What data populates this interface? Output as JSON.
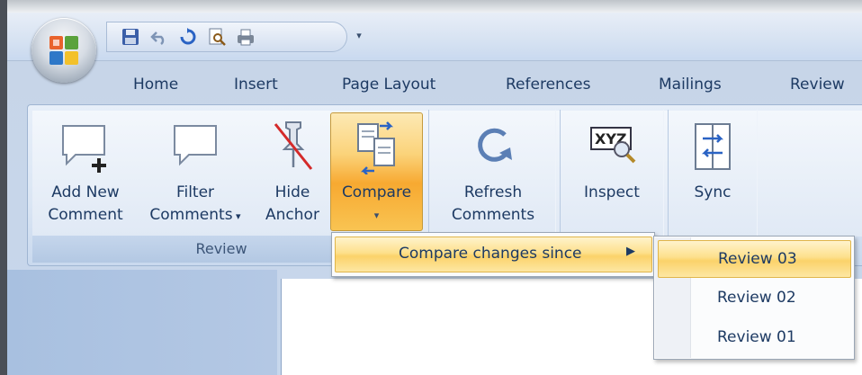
{
  "tabs": [
    "Home",
    "Insert",
    "Page Layout",
    "References",
    "Mailings",
    "Review"
  ],
  "ribbon": {
    "group_label": "Review",
    "buttons": {
      "add_new_comment": [
        "Add New",
        "Comment"
      ],
      "filter_comments": [
        "Filter",
        "Comments"
      ],
      "hide_anchor": [
        "Hide",
        "Anchor"
      ],
      "compare": [
        "Compare"
      ],
      "refresh_comments": [
        "Refresh",
        "Comments"
      ],
      "inspect": [
        "Inspect"
      ],
      "sync": [
        "Sync"
      ]
    }
  },
  "compare_menu": {
    "item": "Compare changes since"
  },
  "submenu": {
    "items": [
      "Review 03",
      "Review 02",
      "Review 01"
    ],
    "selected": "Review 03"
  },
  "icons": {
    "qat": [
      "save-icon",
      "undo-icon",
      "redo-icon",
      "print-preview-icon",
      "print-icon"
    ],
    "office": "office-logo-icon"
  },
  "colors": {
    "accent_highlight": "#fbd26a",
    "text": "#1d3a63",
    "ribbon_bg": "#dbe6f4"
  }
}
